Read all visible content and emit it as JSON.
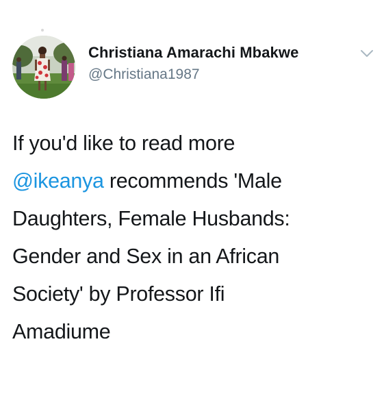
{
  "tweet": {
    "author": {
      "display_name": "Christiana Amarachi Mbakwe",
      "handle": "@Christiana1987",
      "avatar_icon": "profile-photo"
    },
    "menu_icon": "chevron-down-icon",
    "text": {
      "line1": "If you'd like to read more",
      "mention": "@ikeanya",
      "line2_rest": " recommends 'Male",
      "line3": "Daughters, Female Husbands:",
      "line4": "Gender and Sex in an African",
      "line5": "Society' by Professor Ifi",
      "line6": "Amadiume"
    },
    "colors": {
      "text": "#14171a",
      "secondary": "#657786",
      "link": "#1b95e0"
    }
  }
}
